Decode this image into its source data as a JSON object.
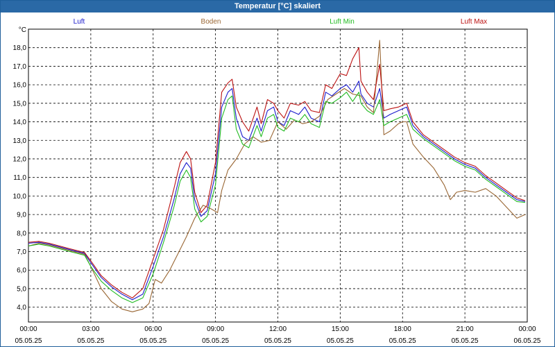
{
  "window": {
    "title": "Temperatur [°C] skaliert"
  },
  "chart_data": {
    "type": "line",
    "title": "Temperatur [°C] skaliert",
    "ylabel": "°C",
    "xlabel": "",
    "ylim": [
      3.2,
      19.0
    ],
    "xlim": [
      0,
      24
    ],
    "grid": true,
    "legend_position": "top",
    "y_ticks": [
      "4,0",
      "5,0",
      "6,0",
      "7,0",
      "8,0",
      "9,0",
      "10,0",
      "11,0",
      "12,0",
      "13,0",
      "14,0",
      "15,0",
      "16,0",
      "17,0",
      "18,0"
    ],
    "y_tick_values": [
      4,
      5,
      6,
      7,
      8,
      9,
      10,
      11,
      12,
      13,
      14,
      15,
      16,
      17,
      18
    ],
    "x_ticks": [
      {
        "hour": 0,
        "time": "00:00",
        "date": "05.05.25"
      },
      {
        "hour": 3,
        "time": "03:00",
        "date": "05.05.25"
      },
      {
        "hour": 6,
        "time": "06:00",
        "date": "05.05.25"
      },
      {
        "hour": 9,
        "time": "09:00",
        "date": "05.05.25"
      },
      {
        "hour": 12,
        "time": "12:00",
        "date": "05.05.25"
      },
      {
        "hour": 15,
        "time": "15:00",
        "date": "05.05.25"
      },
      {
        "hour": 18,
        "time": "18:00",
        "date": "05.05.25"
      },
      {
        "hour": 21,
        "time": "21:00",
        "date": "05.05.25"
      },
      {
        "hour": 24,
        "time": "00:00",
        "date": "06.05.25"
      }
    ],
    "series": [
      {
        "name": "Luft",
        "color": "#1a1acc",
        "points": [
          [
            0,
            7.45
          ],
          [
            0.5,
            7.5
          ],
          [
            1,
            7.4
          ],
          [
            2,
            7.1
          ],
          [
            2.7,
            6.9
          ],
          [
            3,
            6.4
          ],
          [
            3.5,
            5.6
          ],
          [
            4,
            5.1
          ],
          [
            4.5,
            4.7
          ],
          [
            5,
            4.4
          ],
          [
            5.5,
            4.7
          ],
          [
            6,
            6.2
          ],
          [
            6.5,
            7.8
          ],
          [
            7,
            9.8
          ],
          [
            7.3,
            11.2
          ],
          [
            7.6,
            11.8
          ],
          [
            7.8,
            11.5
          ],
          [
            8,
            9.8
          ],
          [
            8.3,
            8.9
          ],
          [
            8.6,
            9.2
          ],
          [
            9,
            11.2
          ],
          [
            9.3,
            14.8
          ],
          [
            9.6,
            15.6
          ],
          [
            9.8,
            15.8
          ],
          [
            10,
            14.2
          ],
          [
            10.3,
            13.2
          ],
          [
            10.6,
            13.0
          ],
          [
            11,
            14.2
          ],
          [
            11.2,
            13.5
          ],
          [
            11.5,
            14.6
          ],
          [
            11.8,
            14.8
          ],
          [
            12,
            14.0
          ],
          [
            12.3,
            13.8
          ],
          [
            12.6,
            14.6
          ],
          [
            13,
            14.4
          ],
          [
            13.3,
            14.8
          ],
          [
            13.6,
            14.2
          ],
          [
            14,
            14.0
          ],
          [
            14.3,
            15.6
          ],
          [
            14.6,
            15.4
          ],
          [
            15,
            15.8
          ],
          [
            15.3,
            16.0
          ],
          [
            15.6,
            15.6
          ],
          [
            15.9,
            16.2
          ],
          [
            16,
            15.5
          ],
          [
            16.3,
            15.0
          ],
          [
            16.6,
            14.8
          ],
          [
            16.9,
            15.8
          ],
          [
            17.1,
            14.2
          ],
          [
            17.4,
            14.4
          ],
          [
            17.8,
            14.6
          ],
          [
            18,
            14.7
          ],
          [
            18.2,
            14.8
          ],
          [
            18.5,
            13.8
          ],
          [
            19,
            13.2
          ],
          [
            19.5,
            12.8
          ],
          [
            20,
            12.4
          ],
          [
            20.5,
            12.0
          ],
          [
            21,
            11.7
          ],
          [
            21.5,
            11.5
          ],
          [
            22,
            11.0
          ],
          [
            22.5,
            10.6
          ],
          [
            23,
            10.2
          ],
          [
            23.5,
            9.8
          ],
          [
            23.9,
            9.7
          ]
        ]
      },
      {
        "name": "Boden",
        "color": "#996633",
        "points": [
          [
            0,
            7.3
          ],
          [
            0.5,
            7.45
          ],
          [
            1,
            7.35
          ],
          [
            2,
            7.05
          ],
          [
            2.7,
            6.85
          ],
          [
            3,
            6.2
          ],
          [
            3.5,
            5.0
          ],
          [
            4,
            4.3
          ],
          [
            4.5,
            3.9
          ],
          [
            5,
            3.75
          ],
          [
            5.5,
            3.9
          ],
          [
            5.8,
            4.2
          ],
          [
            6.1,
            5.5
          ],
          [
            6.4,
            5.3
          ],
          [
            6.8,
            6.0
          ],
          [
            7.2,
            6.9
          ],
          [
            7.6,
            7.8
          ],
          [
            8,
            8.8
          ],
          [
            8.4,
            9.5
          ],
          [
            8.8,
            9.3
          ],
          [
            9.1,
            9.1
          ],
          [
            9.3,
            10.3
          ],
          [
            9.6,
            11.4
          ],
          [
            10,
            12.0
          ],
          [
            10.4,
            12.8
          ],
          [
            10.8,
            13.2
          ],
          [
            11.2,
            12.9
          ],
          [
            11.6,
            13.0
          ],
          [
            12,
            14.0
          ],
          [
            12.4,
            13.6
          ],
          [
            12.8,
            14.1
          ],
          [
            13.2,
            13.9
          ],
          [
            13.6,
            14.0
          ],
          [
            14,
            14.3
          ],
          [
            14.4,
            15.2
          ],
          [
            14.8,
            15.5
          ],
          [
            15.2,
            15.8
          ],
          [
            15.6,
            15.5
          ],
          [
            16,
            15.4
          ],
          [
            16.3,
            14.8
          ],
          [
            16.6,
            14.5
          ],
          [
            16.9,
            18.4
          ],
          [
            17.1,
            13.3
          ],
          [
            17.4,
            13.5
          ],
          [
            17.8,
            13.9
          ],
          [
            18,
            14.0
          ],
          [
            18.2,
            14.0
          ],
          [
            18.5,
            12.8
          ],
          [
            19,
            12.1
          ],
          [
            19.5,
            11.5
          ],
          [
            20,
            10.6
          ],
          [
            20.3,
            9.8
          ],
          [
            20.6,
            10.2
          ],
          [
            21,
            10.3
          ],
          [
            21.5,
            10.2
          ],
          [
            22,
            10.4
          ],
          [
            22.5,
            10.0
          ],
          [
            23,
            9.4
          ],
          [
            23.5,
            8.8
          ],
          [
            23.9,
            9.0
          ]
        ]
      },
      {
        "name": "Luft Min",
        "color": "#22bb22",
        "points": [
          [
            0,
            7.3
          ],
          [
            0.5,
            7.4
          ],
          [
            1,
            7.3
          ],
          [
            2,
            7.0
          ],
          [
            2.7,
            6.8
          ],
          [
            3,
            6.2
          ],
          [
            3.5,
            5.4
          ],
          [
            4,
            4.9
          ],
          [
            4.5,
            4.5
          ],
          [
            5,
            4.25
          ],
          [
            5.5,
            4.5
          ],
          [
            6,
            5.8
          ],
          [
            6.5,
            7.5
          ],
          [
            7,
            9.4
          ],
          [
            7.3,
            10.8
          ],
          [
            7.6,
            11.4
          ],
          [
            7.8,
            11.0
          ],
          [
            8,
            9.3
          ],
          [
            8.3,
            8.6
          ],
          [
            8.6,
            8.9
          ],
          [
            9,
            10.6
          ],
          [
            9.3,
            14.2
          ],
          [
            9.6,
            15.2
          ],
          [
            9.8,
            15.4
          ],
          [
            10,
            13.6
          ],
          [
            10.3,
            12.8
          ],
          [
            10.6,
            12.6
          ],
          [
            11,
            13.8
          ],
          [
            11.2,
            13.2
          ],
          [
            11.5,
            14.2
          ],
          [
            11.8,
            14.4
          ],
          [
            12,
            13.7
          ],
          [
            12.3,
            13.5
          ],
          [
            12.6,
            14.2
          ],
          [
            13,
            14.0
          ],
          [
            13.3,
            14.4
          ],
          [
            13.6,
            13.9
          ],
          [
            14,
            13.7
          ],
          [
            14.3,
            15.1
          ],
          [
            14.6,
            15.0
          ],
          [
            15,
            15.3
          ],
          [
            15.3,
            15.6
          ],
          [
            15.6,
            15.1
          ],
          [
            15.9,
            15.6
          ],
          [
            16,
            15.0
          ],
          [
            16.3,
            14.6
          ],
          [
            16.6,
            14.4
          ],
          [
            16.9,
            15.2
          ],
          [
            17.1,
            13.8
          ],
          [
            17.4,
            14.0
          ],
          [
            17.8,
            14.2
          ],
          [
            18,
            14.3
          ],
          [
            18.2,
            14.4
          ],
          [
            18.5,
            13.6
          ],
          [
            19,
            13.1
          ],
          [
            19.5,
            12.7
          ],
          [
            20,
            12.3
          ],
          [
            20.5,
            11.9
          ],
          [
            21,
            11.6
          ],
          [
            21.5,
            11.4
          ],
          [
            22,
            10.9
          ],
          [
            22.5,
            10.5
          ],
          [
            23,
            10.1
          ],
          [
            23.5,
            9.7
          ],
          [
            23.9,
            9.65
          ]
        ]
      },
      {
        "name": "Luft Max",
        "color": "#bb1111",
        "points": [
          [
            0,
            7.5
          ],
          [
            0.5,
            7.55
          ],
          [
            1,
            7.45
          ],
          [
            2,
            7.15
          ],
          [
            2.7,
            6.95
          ],
          [
            3,
            6.5
          ],
          [
            3.5,
            5.7
          ],
          [
            4,
            5.2
          ],
          [
            4.5,
            4.8
          ],
          [
            5,
            4.5
          ],
          [
            5.5,
            5.0
          ],
          [
            6,
            6.6
          ],
          [
            6.5,
            8.2
          ],
          [
            7,
            10.4
          ],
          [
            7.3,
            11.8
          ],
          [
            7.6,
            12.4
          ],
          [
            7.8,
            12.0
          ],
          [
            8,
            10.2
          ],
          [
            8.3,
            9.1
          ],
          [
            8.6,
            9.5
          ],
          [
            9,
            11.8
          ],
          [
            9.3,
            15.6
          ],
          [
            9.6,
            16.1
          ],
          [
            9.8,
            16.3
          ],
          [
            10,
            14.8
          ],
          [
            10.3,
            14.0
          ],
          [
            10.6,
            13.5
          ],
          [
            11,
            14.8
          ],
          [
            11.2,
            13.9
          ],
          [
            11.5,
            15.2
          ],
          [
            11.8,
            15.0
          ],
          [
            12,
            14.6
          ],
          [
            12.3,
            14.2
          ],
          [
            12.6,
            15.0
          ],
          [
            13,
            14.9
          ],
          [
            13.3,
            15.1
          ],
          [
            13.6,
            14.6
          ],
          [
            14,
            14.5
          ],
          [
            14.3,
            16.0
          ],
          [
            14.6,
            15.8
          ],
          [
            15,
            16.6
          ],
          [
            15.3,
            16.5
          ],
          [
            15.6,
            17.4
          ],
          [
            15.9,
            18.0
          ],
          [
            16,
            16.2
          ],
          [
            16.3,
            15.6
          ],
          [
            16.6,
            15.2
          ],
          [
            16.9,
            17.1
          ],
          [
            17.1,
            14.6
          ],
          [
            17.4,
            14.7
          ],
          [
            17.8,
            14.8
          ],
          [
            18,
            14.9
          ],
          [
            18.2,
            15.0
          ],
          [
            18.5,
            14.0
          ],
          [
            19,
            13.3
          ],
          [
            19.5,
            12.9
          ],
          [
            20,
            12.5
          ],
          [
            20.5,
            12.1
          ],
          [
            21,
            11.8
          ],
          [
            21.5,
            11.6
          ],
          [
            22,
            11.1
          ],
          [
            22.5,
            10.7
          ],
          [
            23,
            10.3
          ],
          [
            23.5,
            9.9
          ],
          [
            23.9,
            9.75
          ]
        ]
      }
    ]
  }
}
